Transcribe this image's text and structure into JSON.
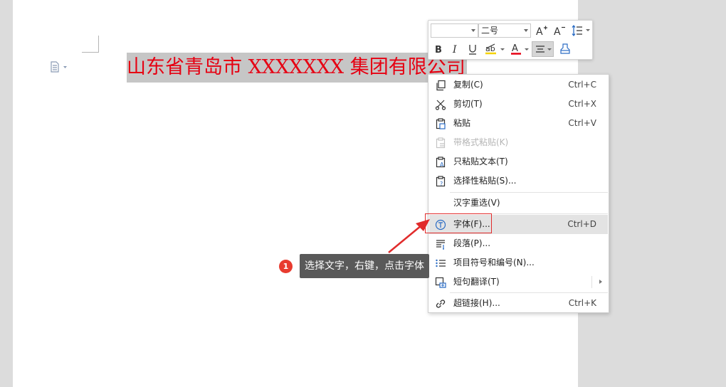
{
  "document": {
    "selected_text": "山东省青岛市 XXXXXXX 集团有限公司"
  },
  "mini_toolbar": {
    "font_name": "",
    "font_size": "二号",
    "buttons": [
      "grow-font",
      "shrink-font",
      "line-spacing",
      "bold",
      "italic",
      "underline",
      "highlight",
      "font-color",
      "align-center",
      "clear-format"
    ],
    "font_color": "#e60012"
  },
  "context_menu": {
    "items": [
      {
        "label": "复制(C)",
        "shortcut": "Ctrl+C",
        "icon": "copy-icon"
      },
      {
        "label": "剪切(T)",
        "shortcut": "Ctrl+X",
        "icon": "cut-icon"
      },
      {
        "label": "粘贴",
        "shortcut": "Ctrl+V",
        "icon": "paste-icon"
      },
      {
        "label": "带格式粘贴(K)",
        "shortcut": "",
        "icon": "paste-format-icon",
        "disabled": true
      },
      {
        "label": "只粘贴文本(T)",
        "shortcut": "",
        "icon": "paste-text-icon"
      },
      {
        "label": "选择性粘贴(S)...",
        "shortcut": "",
        "icon": "paste-special-icon"
      },
      {
        "label": "汉字重选(V)",
        "shortcut": "",
        "icon": ""
      },
      {
        "label": "字体(F)...",
        "shortcut": "Ctrl+D",
        "icon": "font-icon",
        "highlighted": true
      },
      {
        "label": "段落(P)...",
        "shortcut": "",
        "icon": "paragraph-icon"
      },
      {
        "label": "项目符号和编号(N)...",
        "shortcut": "",
        "icon": "bullets-icon"
      },
      {
        "label": "短句翻译(T)",
        "shortcut": "",
        "icon": "translate-icon",
        "submenu": true
      },
      {
        "label": "超链接(H)...",
        "shortcut": "Ctrl+K",
        "icon": "link-icon"
      }
    ]
  },
  "annotation": {
    "number": "1",
    "text": "选择文字，右键，点击字体"
  },
  "colors": {
    "highlight_box": "#e12b2b",
    "callout_bg": "#595959",
    "callout_num_bg": "#e83b2f"
  }
}
